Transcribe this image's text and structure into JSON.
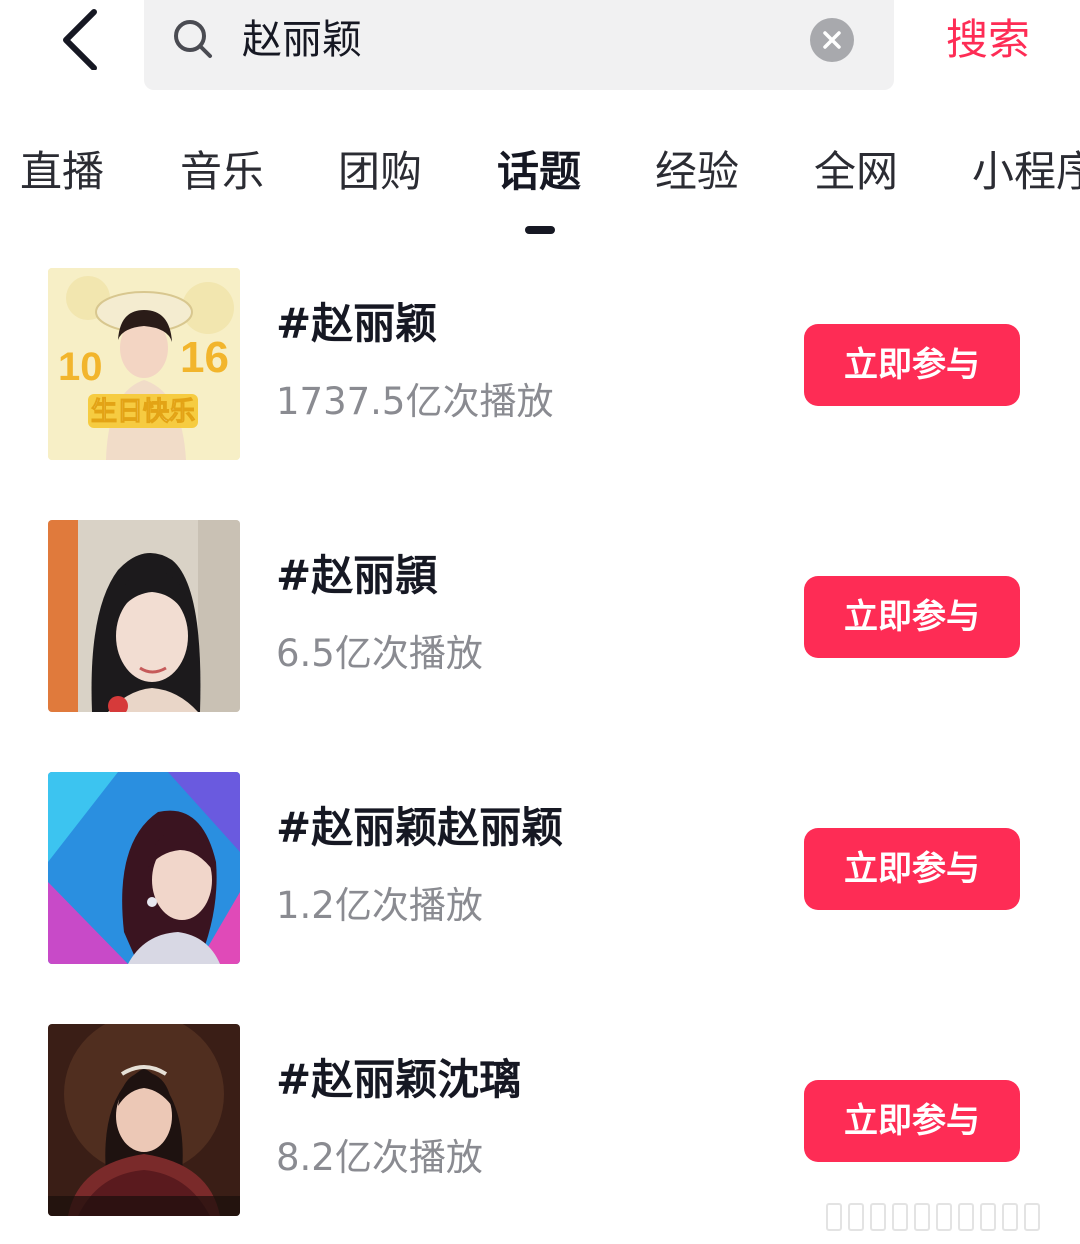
{
  "search": {
    "query": "赵丽颖",
    "submit_label": "搜索"
  },
  "tabs": [
    {
      "label": "直播",
      "active": false
    },
    {
      "label": "音乐",
      "active": false
    },
    {
      "label": "团购",
      "active": false
    },
    {
      "label": "话题",
      "active": true
    },
    {
      "label": "经验",
      "active": false
    },
    {
      "label": "全网",
      "active": false
    },
    {
      "label": "小程序",
      "active": false
    }
  ],
  "topics": [
    {
      "title": "#赵丽颖",
      "views": "1737.5亿次播放",
      "join_label": "立即参与",
      "thumb_text": {
        "left_num": "10",
        "right_num": "16",
        "caption": "生日快乐"
      }
    },
    {
      "title": "#赵丽頴",
      "views": "6.5亿次播放",
      "join_label": "立即参与"
    },
    {
      "title": "#赵丽颖赵丽颖",
      "views": "1.2亿次播放",
      "join_label": "立即参与"
    },
    {
      "title": "#赵丽颖沈璃",
      "views": "8.2亿次播放",
      "join_label": "立即参与"
    }
  ],
  "colors": {
    "accent": "#fe2c55",
    "text_primary": "#161823",
    "text_secondary": "#8a8b91",
    "search_bg": "#f1f1f2"
  }
}
